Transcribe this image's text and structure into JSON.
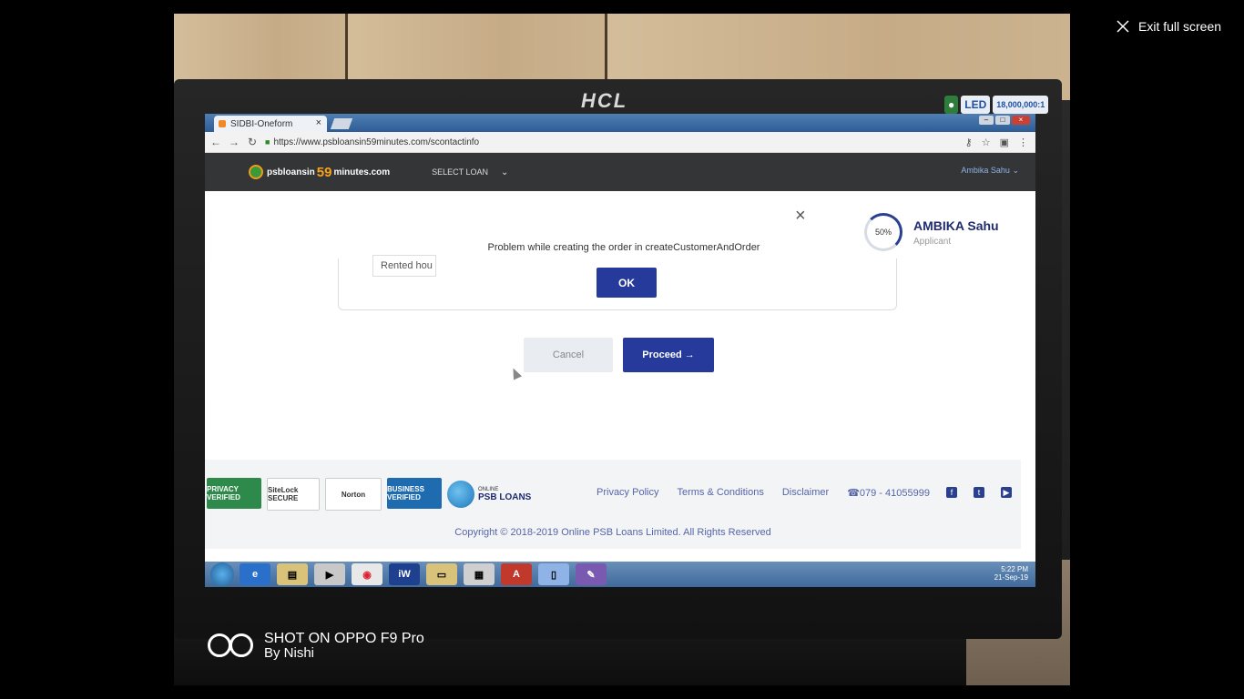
{
  "viewer": {
    "exit_label": "Exit full screen"
  },
  "monitor": {
    "brand": "HCL",
    "badges": [
      "LED",
      "18,000,000:1"
    ]
  },
  "browser": {
    "tab_title": "SIDBI-Oneform",
    "url": "https://www.psbloansin59minutes.com/scontactinfo"
  },
  "site": {
    "logo_text_left": "psbloansin",
    "logo_text_big": "59",
    "logo_text_right": "minutes.com",
    "select_loan": "SELECT LOAN",
    "user_menu": "Ambika Sahu"
  },
  "applicant": {
    "progress": "50%",
    "name": "AMBIKA Sahu",
    "role": "Applicant"
  },
  "form": {
    "residence_value": "Rented hou"
  },
  "dialog": {
    "message": "Problem while creating the order in createCustomerAndOrder",
    "ok_label": "OK"
  },
  "actions": {
    "cancel_label": "Cancel",
    "proceed_label": "Proceed →"
  },
  "footer": {
    "seals": [
      "PRIVACY VERIFIED",
      "SiteLock SECURE",
      "Norton",
      "BUSINESS VERIFIED"
    ],
    "psb_small": "ONLINE",
    "psb_name": "PSB LOANS",
    "links": [
      "Privacy Policy",
      "Terms & Conditions",
      "Disclaimer"
    ],
    "phone": "☎079 - 41055999",
    "copyright": "Copyright © 2018-2019 Online PSB Loans Limited. All Rights Reserved"
  },
  "taskbar": {
    "time": "5:22 PM",
    "date": "21-Sep-19"
  },
  "watermark": {
    "line1": "SHOT ON OPPO F9 Pro",
    "line2": "By Nishi"
  }
}
